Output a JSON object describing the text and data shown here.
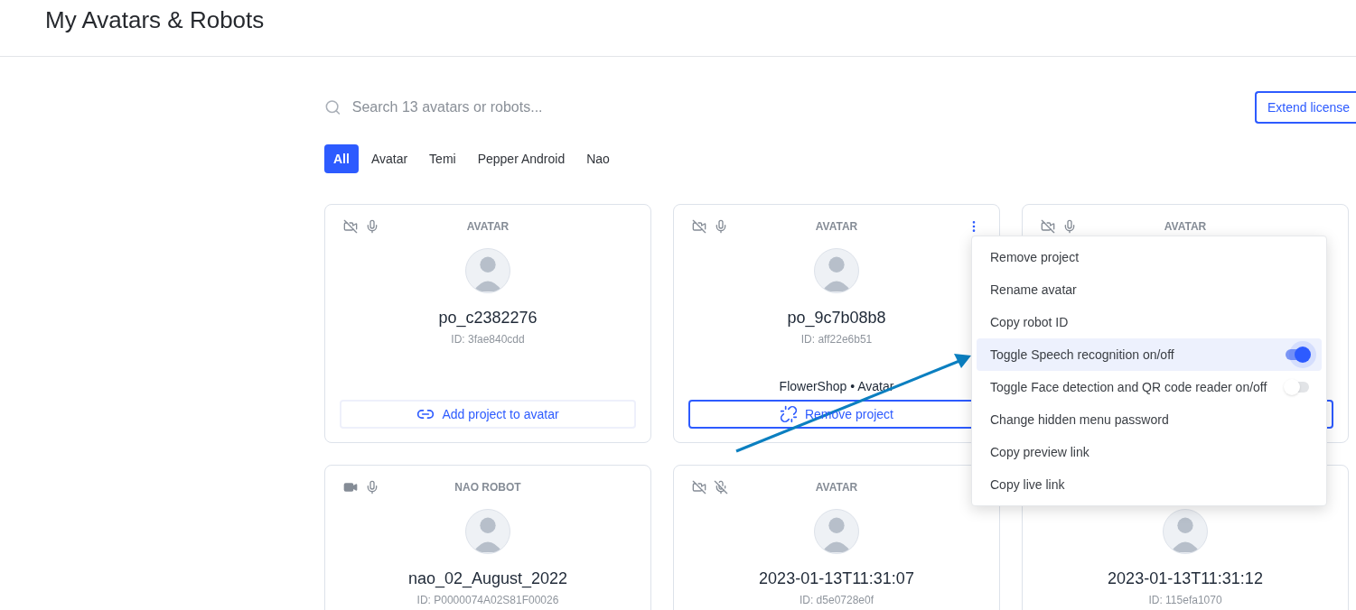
{
  "page": {
    "title": "My Avatars & Robots"
  },
  "search": {
    "placeholder": "Search 13 avatars or robots..."
  },
  "extend_button": {
    "label": "Extend license"
  },
  "filters": [
    {
      "label": "All",
      "selected": true
    },
    {
      "label": "Avatar",
      "selected": false
    },
    {
      "label": "Temi",
      "selected": false
    },
    {
      "label": "Pepper Android",
      "selected": false
    },
    {
      "label": "Nao",
      "selected": false
    }
  ],
  "cards": [
    {
      "type": "AVATAR",
      "camera_on": false,
      "mic_on": true,
      "name": "po_c2382276",
      "id": "ID: 3fae840cdd",
      "button": {
        "kind": "add",
        "label": "Add project to avatar"
      }
    },
    {
      "type": "AVATAR",
      "camera_on": false,
      "mic_on": true,
      "menu_button": true,
      "name": "po_9c7b08b8",
      "id": "ID: aff22e6b51",
      "project": "FlowerShop • Avatar",
      "button": {
        "kind": "remove",
        "label": "Remove project"
      }
    },
    {
      "type": "AVATAR",
      "camera_on": false,
      "mic_on": true,
      "button": {
        "kind": "remove"
      }
    },
    {
      "type": "NAO ROBOT",
      "camera_on": true,
      "mic_on": true,
      "name": "nao_02_August_2022",
      "id": "ID: P0000074A02S81F00026"
    },
    {
      "type": "AVATAR",
      "camera_on": false,
      "mic_on": false,
      "name": "2023-01-13T11:31:07",
      "id": "ID: d5e0728e0f"
    },
    {
      "name": "2023-01-13T11:31:12",
      "id": "ID: 115efa1070"
    }
  ],
  "menu": {
    "items": [
      {
        "label": "Remove project",
        "kind": "action",
        "highlighted": false
      },
      {
        "label": "Rename avatar",
        "kind": "action",
        "highlighted": false
      },
      {
        "label": "Copy robot ID",
        "kind": "action",
        "highlighted": false
      },
      {
        "label": "Toggle Speech recognition on/off",
        "kind": "toggle",
        "on": true,
        "highlighted": true
      },
      {
        "label": "Toggle Face detection and QR code reader on/off",
        "kind": "toggle",
        "on": false,
        "highlighted": false
      },
      {
        "label": "Change hidden menu password",
        "kind": "action",
        "highlighted": false
      },
      {
        "label": "Copy preview link",
        "kind": "action",
        "highlighted": false
      },
      {
        "label": "Copy live link",
        "kind": "action",
        "highlighted": false
      }
    ]
  }
}
